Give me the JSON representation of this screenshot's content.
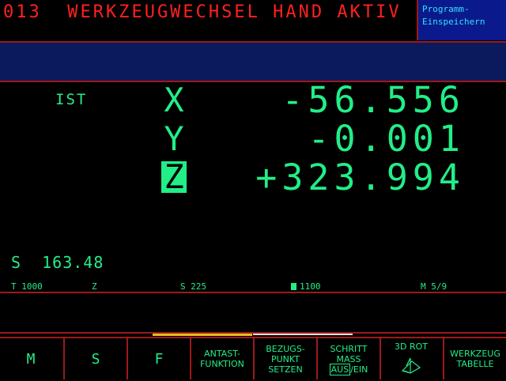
{
  "header": {
    "message": "013  WERKZEUGWECHSEL HAND AKTIV",
    "mode_line1": "Programm-",
    "mode_line2": "Einspeichern"
  },
  "position": {
    "label": "IST",
    "axes": [
      {
        "name": "X",
        "value": "-56.556",
        "selected": false
      },
      {
        "name": "Y",
        "value": "-0.001",
        "selected": false
      },
      {
        "name": "Z",
        "value": "+323.994",
        "selected": true
      }
    ]
  },
  "spindle": "S  163.48",
  "status": {
    "tool": "T 1000",
    "tool_axis": "Z",
    "speed": "S 225",
    "feed": "1100",
    "misc": "M 5/9"
  },
  "softkeys": {
    "m": "M",
    "s": "S",
    "f": "F",
    "antast_l1": "ANTAST-",
    "antast_l2": "FUNKTION",
    "bezug_l1": "BEZUGS-",
    "bezug_l2": "PUNKT",
    "bezug_l3": "SETZEN",
    "schritt_l1": "SCHRITT",
    "schritt_l2": "MASS",
    "schritt_aus": "AUS",
    "schritt_sep": "/",
    "schritt_ein": "EIN",
    "rot_label": "3D ROT",
    "werkz_l1": "WERKZEUG",
    "werkz_l2": "TABELLE"
  },
  "colors": {
    "accent_green": "#22ee88",
    "header_red": "#ff2020",
    "frame_red": "#a01818",
    "mode_blue": "#0a1a8c"
  }
}
